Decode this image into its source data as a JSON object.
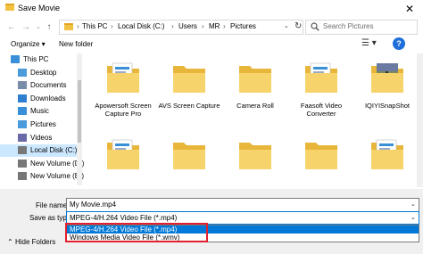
{
  "window": {
    "title": "Save Movie"
  },
  "address": {
    "crumbs": [
      "This PC",
      "Local Disk (C:)",
      "Users",
      "MR",
      "Pictures"
    ]
  },
  "search": {
    "placeholder": "Search Pictures"
  },
  "toolbar": {
    "organize_label": "Organize ▾",
    "new_folder_label": "New folder"
  },
  "nav": {
    "items": [
      {
        "label": "This PC",
        "icon": "computer-icon"
      },
      {
        "label": "Desktop",
        "icon": "desktop-icon"
      },
      {
        "label": "Documents",
        "icon": "documents-icon"
      },
      {
        "label": "Downloads",
        "icon": "downloads-icon"
      },
      {
        "label": "Music",
        "icon": "music-icon"
      },
      {
        "label": "Pictures",
        "icon": "pictures-icon"
      },
      {
        "label": "Videos",
        "icon": "videos-icon"
      },
      {
        "label": "Local Disk (C:)",
        "icon": "drive-icon"
      },
      {
        "label": "New Volume (D:)",
        "icon": "drive-icon"
      },
      {
        "label": "New Volume (E:)",
        "icon": "drive-icon"
      }
    ],
    "selected": 7
  },
  "files": [
    {
      "name": "Apowersoft Screen Capture Pro",
      "thumb": "doc"
    },
    {
      "name": "AVS Screen Capture",
      "thumb": "plain"
    },
    {
      "name": "Camera Roll",
      "thumb": "plain"
    },
    {
      "name": "Faasoft Video Converter",
      "thumb": "doc"
    },
    {
      "name": "IQIYISnapShot",
      "thumb": "photo"
    },
    {
      "name": "",
      "thumb": "doc"
    },
    {
      "name": "",
      "thumb": "plain"
    },
    {
      "name": "",
      "thumb": "plain"
    },
    {
      "name": "",
      "thumb": "plain"
    },
    {
      "name": "",
      "thumb": "doc"
    }
  ],
  "form": {
    "file_name_label": "File name:",
    "file_name_value": "My Movie.mp4",
    "save_type_label": "Save as type:",
    "save_type_value": "MPEG-4/H.264 Video File (*.mp4)",
    "options": [
      "MPEG-4/H.264 Video File (*.mp4)",
      "Windows Media Video File (*.wmv)"
    ]
  },
  "hide_folders_label": "Hide Folders",
  "colors": {
    "accent": "#0078d7",
    "highlight": "#e0202e",
    "folder": "#f4c242"
  }
}
